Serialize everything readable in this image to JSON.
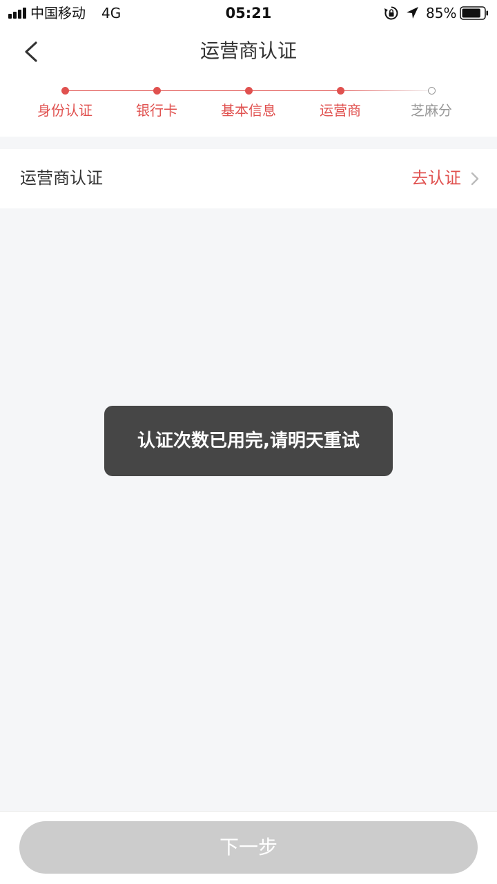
{
  "status_bar": {
    "carrier": "中国移动",
    "network": "4G",
    "time": "05:21",
    "battery_percent": "85%",
    "battery_level": 0.85,
    "icons": [
      "signal-icon",
      "rotation-lock-icon",
      "location-arrow-icon",
      "battery-icon"
    ]
  },
  "header": {
    "title": "运营商认证",
    "back_icon": "chevron-left-icon"
  },
  "steps": {
    "items": [
      {
        "label": "身份认证",
        "done": true
      },
      {
        "label": "银行卡",
        "done": true
      },
      {
        "label": "基本信息",
        "done": true
      },
      {
        "label": "运营商",
        "done": true
      },
      {
        "label": "芝麻分",
        "done": false
      }
    ],
    "done_color": "#e0514f",
    "todo_color": "#999999"
  },
  "operator_row": {
    "label": "运营商认证",
    "action": "去认证",
    "action_color": "#e0514f",
    "chevron_icon": "chevron-right-icon"
  },
  "toast": {
    "message": "认证次数已用完,请明天重试"
  },
  "footer": {
    "next_label": "下一步",
    "button_color": "#cccccc"
  }
}
